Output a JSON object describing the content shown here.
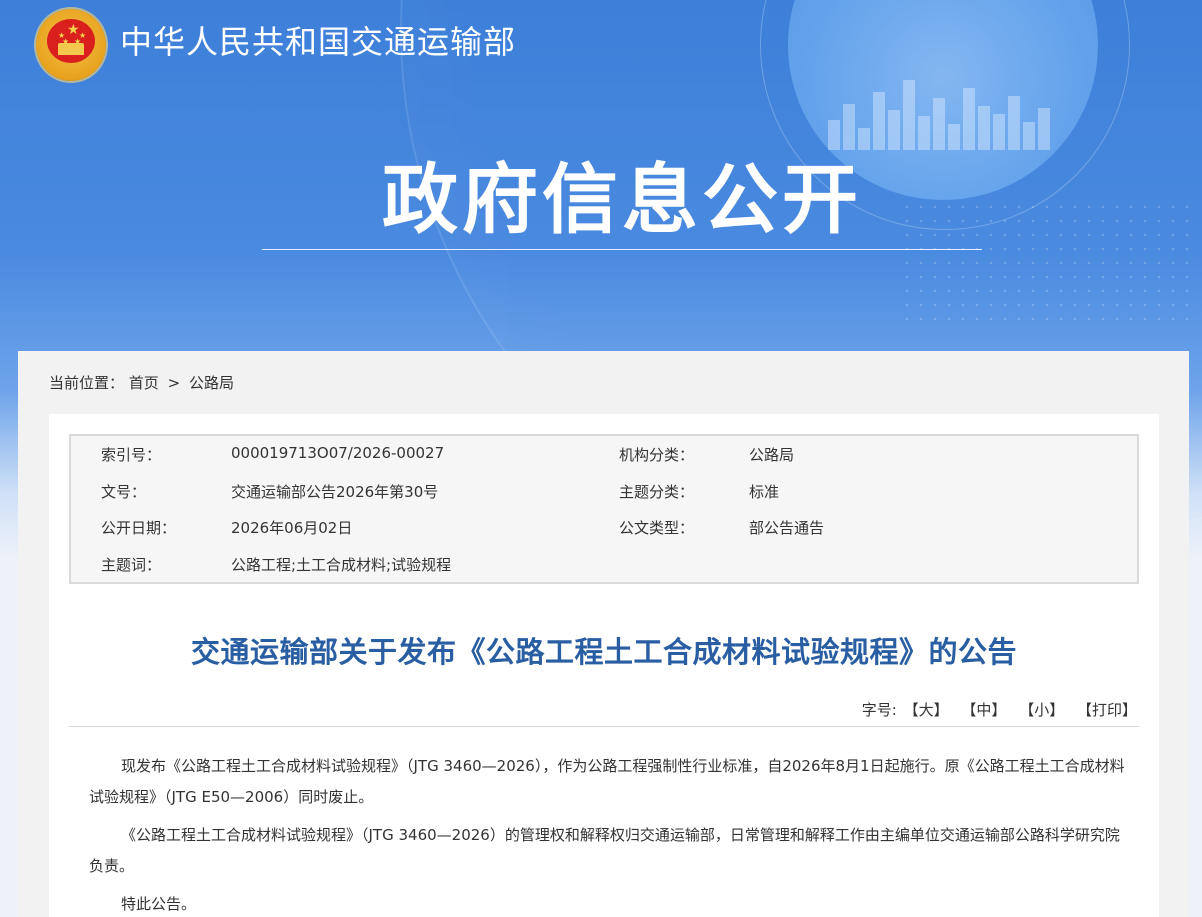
{
  "header": {
    "site_name": "中华人民共和国交通运输部",
    "section_title": "政府信息公开"
  },
  "breadcrumb": {
    "label": "当前位置：",
    "items": [
      "首页",
      "公路局"
    ],
    "separator": ">"
  },
  "meta": {
    "rows": [
      {
        "k1": "索引号：",
        "v1": "000019713O07/2026-00027",
        "k2": "机构分类：",
        "v2": "公路局"
      },
      {
        "k1": "文号：",
        "v1": "交通运输部公告2026年第30号",
        "k2": "主题分类：",
        "v2": "标准"
      },
      {
        "k1": "公开日期：",
        "v1": "2026年06月02日",
        "k2": "公文类型：",
        "v2": "部公告通告"
      },
      {
        "k1": "主题词：",
        "v1": "公路工程;土工合成材料;试验规程",
        "k2": "",
        "v2": ""
      }
    ]
  },
  "document": {
    "title": "交通运输部关于发布《公路工程土工合成材料试验规程》的公告",
    "font_size_label": "字号:",
    "font_size_options": [
      "【大】",
      "【中】",
      "【小】"
    ],
    "print_label": "【打印】",
    "paragraphs": [
      "现发布《公路工程土工合成材料试验规程》（JTG 3460—2026），作为公路工程强制性行业标准，自2026年8月1日起施行。原《公路工程土工合成材料试验规程》（JTG E50—2006）同时废止。",
      "《公路工程土工合成材料试验规程》（JTG 3460—2026）的管理权和解释权归交通运输部，日常管理和解释工作由主编单位交通运输部公路科学研究院负责。",
      "特此公告。"
    ]
  },
  "colors": {
    "banner_blue": "#3d7fd9",
    "title_blue": "#2a5ea3",
    "emblem_gold": "#e8a21c",
    "emblem_red": "#d9201d"
  }
}
